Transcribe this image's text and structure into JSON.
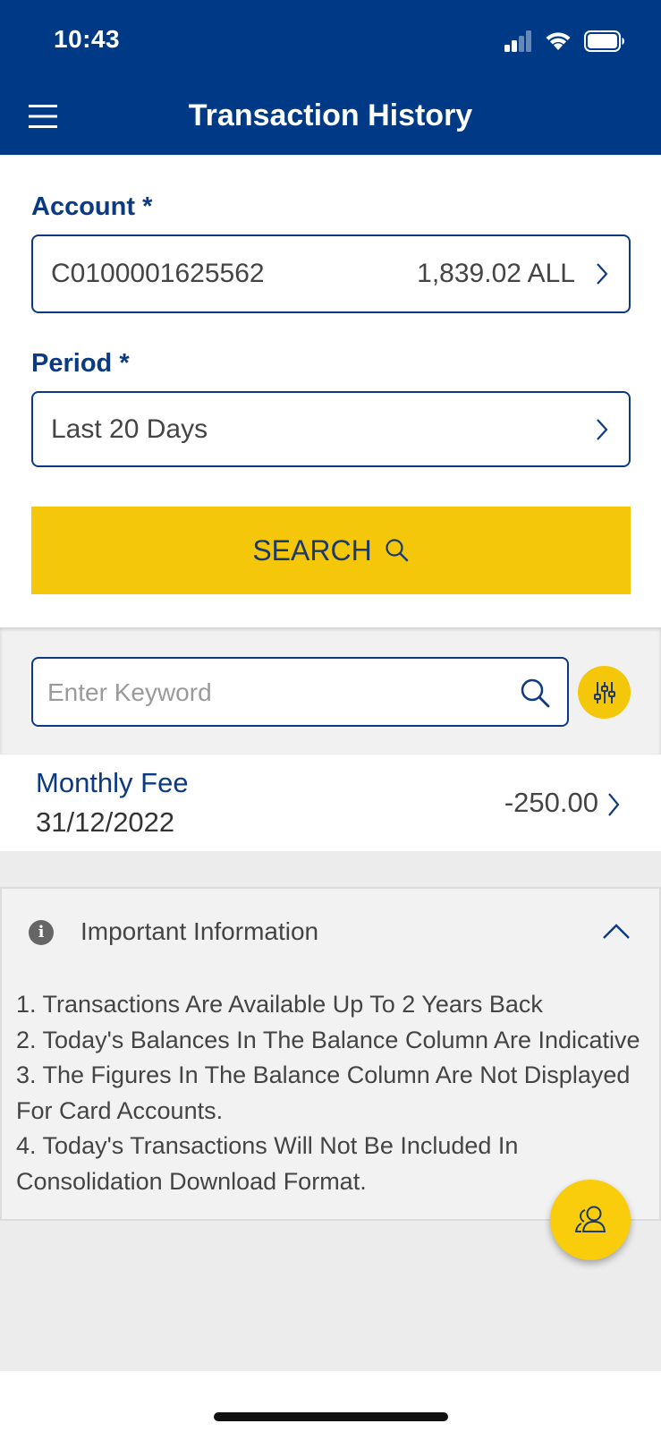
{
  "status": {
    "time": "10:43"
  },
  "nav": {
    "title": "Transaction History"
  },
  "form": {
    "account_label": "Account",
    "account_number": "C0100001625562",
    "account_balance": "1,839.02 ALL",
    "period_label": "Period",
    "period_value": "Last 20 Days",
    "required_mark": "*",
    "search_label": "SEARCH"
  },
  "filter": {
    "keyword_placeholder": "Enter Keyword"
  },
  "transactions": [
    {
      "name": "Monthly Fee",
      "date": "31/12/2022",
      "amount": "-250.00"
    }
  ],
  "info": {
    "title": "Important Information",
    "lines": [
      "1. Transactions Are Available Up To 2 Years Back",
      "2. Today's Balances In The Balance Column Are Indicative",
      "3. The Figures In The Balance Column Are Not Displayed For Card Accounts.",
      "4. Today's Transactions Will Not Be Included In Consolidation Download Format."
    ]
  },
  "colors": {
    "primary": "#003a86",
    "accent": "#f4c70b"
  }
}
